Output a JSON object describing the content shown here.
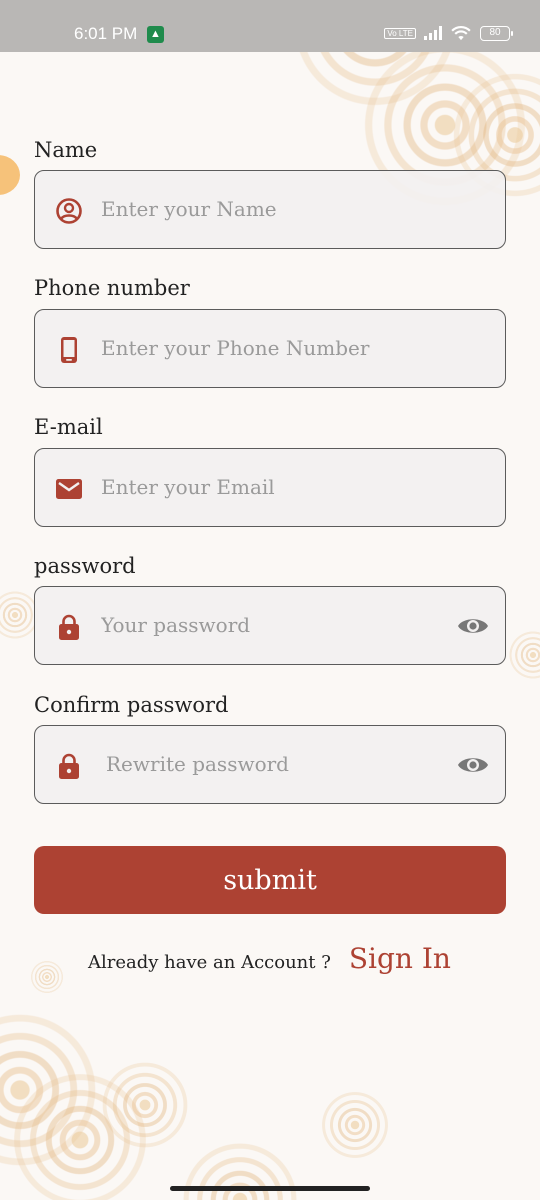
{
  "status_bar": {
    "time": "6:01 PM",
    "network_badge": "Vo LTE",
    "battery": "80",
    "notification_icon": "gallery-app-icon"
  },
  "form": {
    "fields": [
      {
        "label": "Name",
        "placeholder": "Enter your Name",
        "icon": "user-circle-icon"
      },
      {
        "label": "Phone number",
        "placeholder": "Enter your Phone Number",
        "icon": "phone-icon"
      },
      {
        "label": "E-mail",
        "placeholder": "Enter your Email",
        "icon": "mail-icon"
      },
      {
        "label": "password",
        "placeholder": "Your password",
        "icon": "lock-icon",
        "trailing_icon": "eye-icon"
      },
      {
        "label": "Confirm password",
        "placeholder": "Rewrite password",
        "icon": "lock-icon",
        "trailing_icon": "eye-icon"
      }
    ],
    "submit_label": "submit"
  },
  "signin": {
    "prompt": "Already have an Account ?",
    "link": "Sign In"
  },
  "colors": {
    "accent": "#ad4233",
    "field_border": "#5b5b5b",
    "field_bg": "#f2f0f0",
    "icon_gray": "#777777"
  }
}
